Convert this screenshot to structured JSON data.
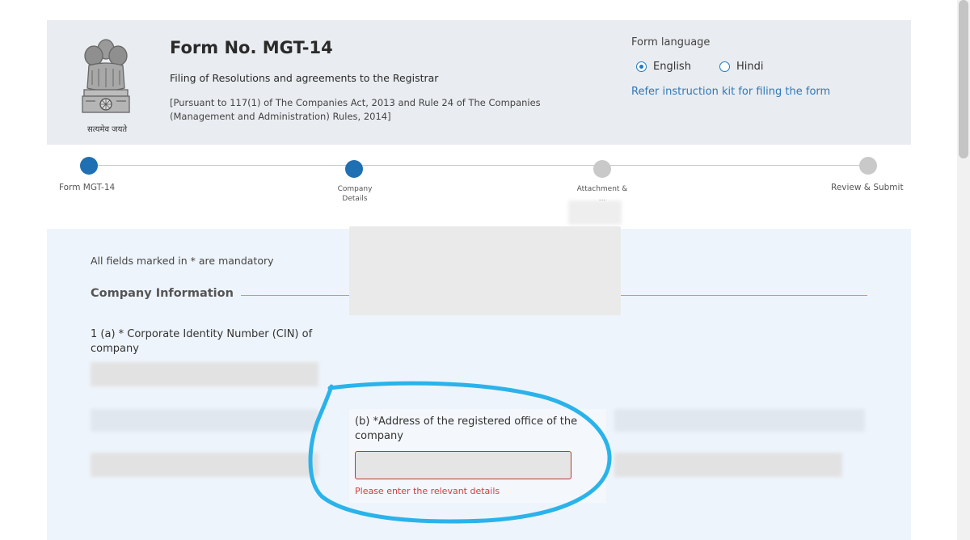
{
  "header": {
    "emblem_caption": "सत्यमेव जयते",
    "title": "Form No. MGT-14",
    "subtitle": "Filing of Resolutions and agreements to the Registrar",
    "pursuant": "[Pursuant to 117(1) of The Companies Act, 2013 and Rule 24 of The Companies (Management and Administration) Rules, 2014]",
    "language_label": "Form language",
    "languages": [
      {
        "label": "English",
        "selected": true
      },
      {
        "label": "Hindi",
        "selected": false
      }
    ],
    "instruction_link": "Refer instruction kit for filing the form"
  },
  "stepper": {
    "steps": [
      {
        "label": "Form MGT-14",
        "state": "completed"
      },
      {
        "label": "Company Details",
        "state": "active"
      },
      {
        "label": "Attachment & ...",
        "state": "pending"
      },
      {
        "label": "Review & Submit",
        "state": "pending"
      }
    ]
  },
  "form": {
    "mandatory_note": "All fields marked in  * are mandatory",
    "section_title": "Company Information",
    "cin_label": "1 (a) * Corporate Identity Number (CIN) of company",
    "address_label": "(b) *Address of the registered office of the company",
    "address_value": "",
    "address_error": "Please enter the relevant details"
  },
  "colors": {
    "accent": "#1f6fb3",
    "link": "#2f78b7",
    "error": "#d0413d",
    "annotation": "#2ab3ea",
    "section_rule": "#c9a15a"
  }
}
